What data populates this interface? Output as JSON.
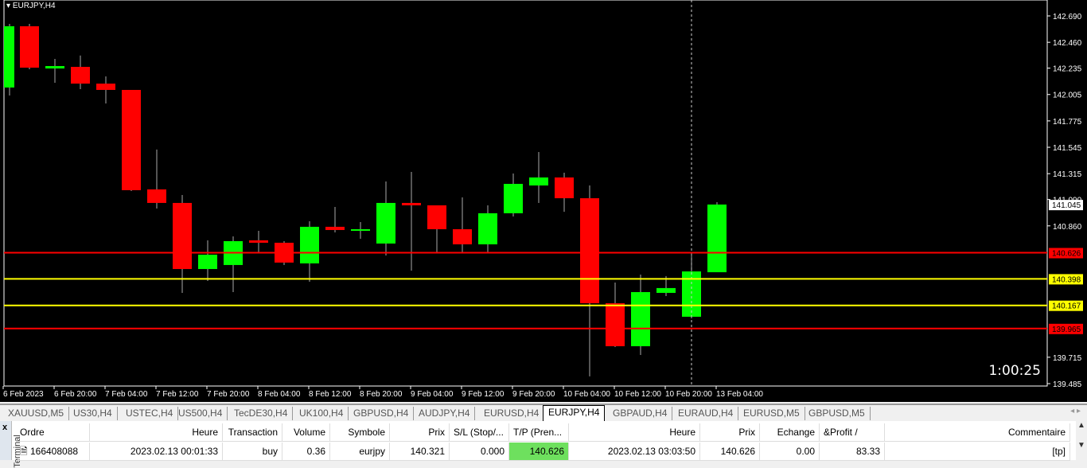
{
  "chart": {
    "title": "EURJPY,H4",
    "timer": "1:00:25",
    "colors": {
      "bull": "#00ff00",
      "bear": "#ff0000",
      "level_red": "#ff0000",
      "level_yellow": "#ffff00",
      "bg": "#000000"
    },
    "price_ticks": [
      "142.690",
      "142.460",
      "142.235",
      "142.005",
      "141.775",
      "141.545",
      "141.315",
      "141.090",
      "140.860",
      "139.715",
      "139.485"
    ],
    "levels": [
      {
        "price": 140.626,
        "label": "140.626",
        "color": "#ff0000"
      },
      {
        "price": 140.398,
        "label": "140.398",
        "color": "#ffff00"
      },
      {
        "price": 140.167,
        "label": "140.167",
        "color": "#ffff00"
      },
      {
        "price": 139.965,
        "label": "139.965",
        "color": "#ff0000"
      }
    ],
    "current_price": {
      "price": 141.045,
      "label": "141.045"
    },
    "time_labels": [
      "6 Feb 2023",
      "6 Feb 20:00",
      "7 Feb 04:00",
      "7 Feb 12:00",
      "7 Feb 20:00",
      "8 Feb 04:00",
      "8 Feb 12:00",
      "8 Feb 20:00",
      "9 Feb 04:00",
      "9 Feb 12:00",
      "9 Feb 20:00",
      "10 Feb 04:00",
      "10 Feb 12:00",
      "10 Feb 20:00",
      "13 Feb 04:00"
    ]
  },
  "chart_data": {
    "type": "candlestick",
    "title": "EURJPY,H4",
    "ylim": [
      139.485,
      142.69
    ],
    "ohlc": [
      [
        142.066,
        142.621,
        141.996,
        142.6
      ],
      [
        142.6,
        142.621,
        142.225,
        142.239
      ],
      [
        142.232,
        142.315,
        142.107,
        142.253
      ],
      [
        142.246,
        142.345,
        142.052,
        142.1
      ],
      [
        142.1,
        142.163,
        141.927,
        142.045
      ],
      [
        142.045,
        142.045,
        141.164,
        141.171
      ],
      [
        141.178,
        141.525,
        141.011,
        141.06
      ],
      [
        141.06,
        141.129,
        140.276,
        140.484
      ],
      [
        140.484,
        140.734,
        140.38,
        140.609
      ],
      [
        140.519,
        140.768,
        140.283,
        140.727
      ],
      [
        140.734,
        140.817,
        140.623,
        140.713
      ],
      [
        140.713,
        140.727,
        140.519,
        140.54
      ],
      [
        140.533,
        140.9,
        140.373,
        140.852
      ],
      [
        140.852,
        141.025,
        140.803,
        140.824
      ],
      [
        140.817,
        140.893,
        140.748,
        140.831
      ],
      [
        140.706,
        141.247,
        140.602,
        141.06
      ],
      [
        141.06,
        141.33,
        140.47,
        141.039
      ],
      [
        141.039,
        141.039,
        140.623,
        140.831
      ],
      [
        140.831,
        141.108,
        140.623,
        140.699
      ],
      [
        140.699,
        141.039,
        140.623,
        140.97
      ],
      [
        140.97,
        141.316,
        140.942,
        141.226
      ],
      [
        141.212,
        141.504,
        141.06,
        141.282
      ],
      [
        141.282,
        141.323,
        140.983,
        141.101
      ],
      [
        141.101,
        141.212,
        139.548,
        140.186
      ],
      [
        140.186,
        140.366,
        139.804,
        139.811
      ],
      [
        139.811,
        140.435,
        139.735,
        140.283
      ],
      [
        140.276,
        140.422,
        140.248,
        140.318
      ],
      [
        140.068,
        140.623,
        140.054,
        140.463
      ],
      [
        140.456,
        141.067,
        140.456,
        141.046
      ]
    ]
  },
  "tabs": [
    "XAUUSD,M5",
    "US30,H4",
    "USTEC,H4",
    "US500,H4",
    "TecDE30,H4",
    "UK100,H4",
    "GBPUSD,H4",
    "AUDJPY,H4",
    "EURUSD,H4",
    "EURJPY,H4",
    "GBPAUD,H4",
    "EURAUD,H4",
    "EURUSD,M5",
    "GBPUSD,M5"
  ],
  "active_tab": "EURJPY,H4",
  "terminal": {
    "side_label": "Terminal",
    "close": "x",
    "headers": [
      "Ordre",
      "Heure",
      "Transaction",
      "Volume",
      "Symbole",
      "Prix",
      "S/L (Stop/...",
      "T/P (Pren...",
      "Heure",
      "Prix",
      "Echange",
      "&Profit  /",
      "Commentaire"
    ],
    "row": [
      "166408088",
      "2023.02.13 00:01:33",
      "buy",
      "0.36",
      "eurjpy",
      "140.321",
      "0.000",
      "140.626",
      "2023.02.13 03:03:50",
      "140.626",
      "0.00",
      "83.33",
      "[tp]"
    ]
  }
}
